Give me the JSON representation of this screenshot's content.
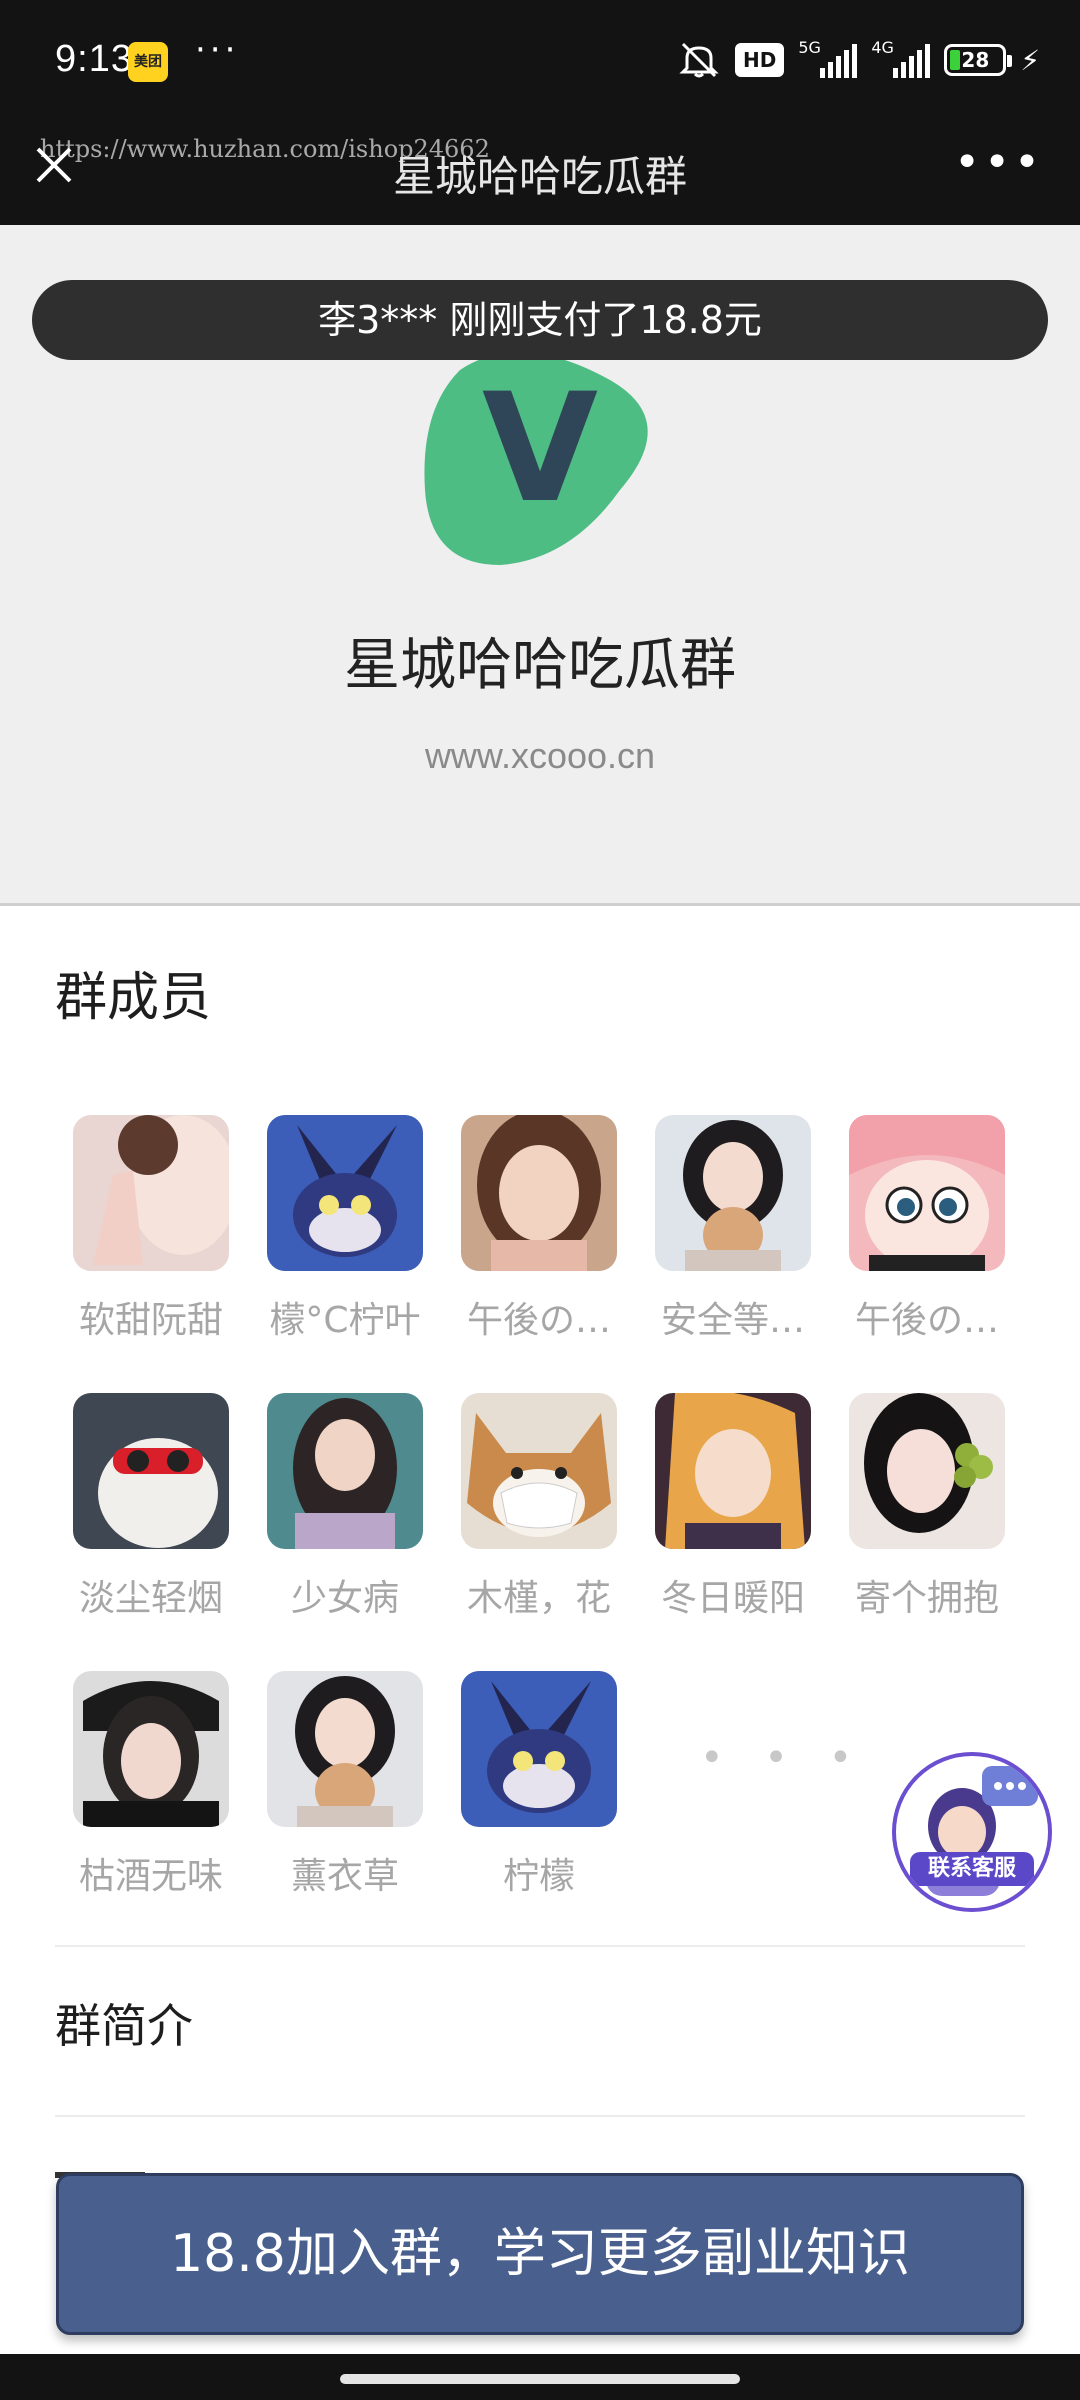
{
  "status_bar": {
    "time": "9:13",
    "app_badge": "美团",
    "more": "···",
    "hd": "HD",
    "net1": "5G",
    "net2": "4G",
    "battery": "28"
  },
  "nav": {
    "title": "星城哈哈吃瓜群",
    "watermark": "https://www.huzhan.com/ishop24662",
    "more": "•••"
  },
  "toast": "李3*** 刚刚支付了18.8元",
  "group": {
    "name": "星城哈哈吃瓜群",
    "site": "www.xcooo.cn",
    "logo_letter": "V",
    "logo_color": "#4dbd84"
  },
  "members": {
    "title": "群成员",
    "list": [
      {
        "name": "软甜阮甜"
      },
      {
        "name": "檬°C柠叶"
      },
      {
        "name": "午後の…"
      },
      {
        "name": "安全等…"
      },
      {
        "name": "午後の…"
      },
      {
        "name": "淡尘轻烟"
      },
      {
        "name": "少女病"
      },
      {
        "name": "木槿，花"
      },
      {
        "name": "冬日暖阳"
      },
      {
        "name": "寄个拥抱"
      },
      {
        "name": "枯酒无味"
      },
      {
        "name": "薰衣草"
      },
      {
        "name": "柠檬"
      }
    ],
    "more": "• • •"
  },
  "service": {
    "label": "联系客服"
  },
  "intro": {
    "title": "群简介"
  },
  "cta": {
    "label": "18.8加入群，学习更多副业知识"
  },
  "colors": {
    "cta_bg": "#49608e",
    "header_bg": "#efefef",
    "status_bg": "#131313",
    "service_accent": "#5b48c9"
  }
}
